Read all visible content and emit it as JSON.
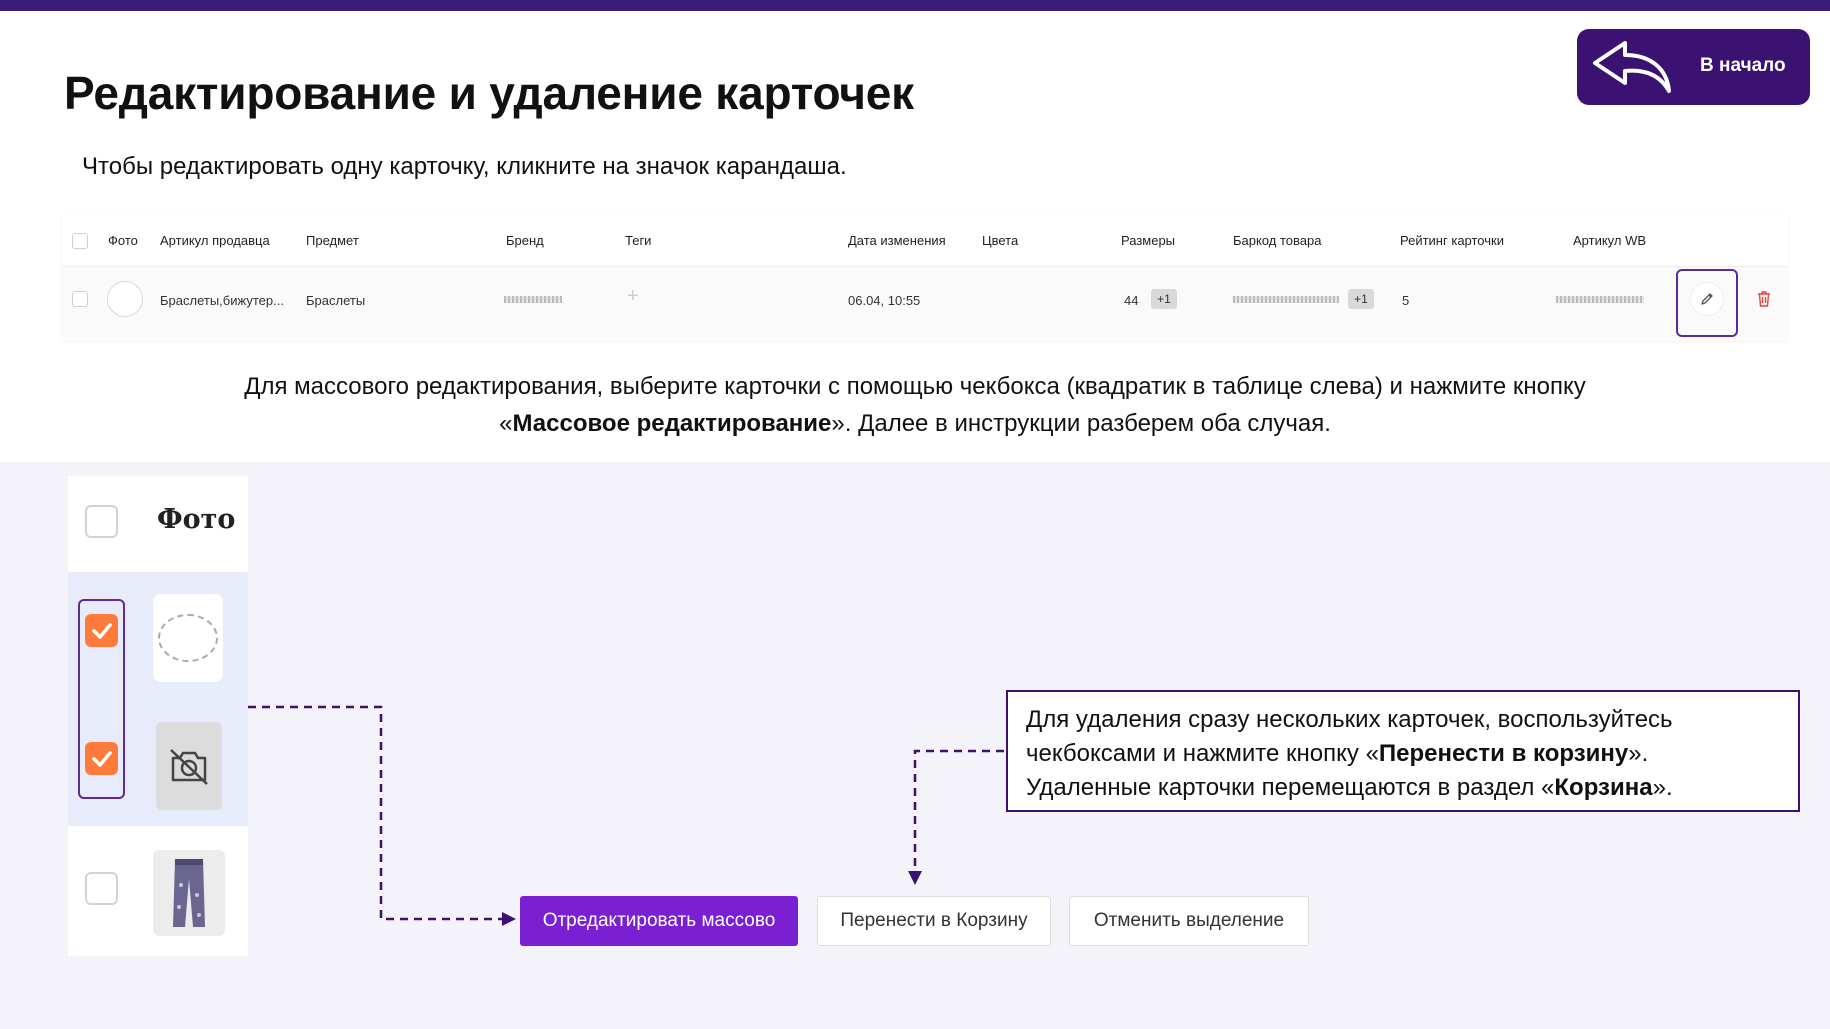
{
  "header": {
    "title": "Редактирование и удаление карточек",
    "home_button": "В начало",
    "subtitle": "Чтобы редактировать одну карточку, кликните на значок карандаша."
  },
  "table": {
    "columns": [
      "Фото",
      "Артикул продавца",
      "Предмет",
      "Бренд",
      "Теги",
      "Дата изменения",
      "Цвета",
      "Размеры",
      "Баркод товара",
      "Рейтинг карточки",
      "Артикул WB"
    ],
    "row": {
      "seller_article": "Браслеты,бижутер...",
      "subject": "Браслеты",
      "tags_add": "+",
      "date": "06.04, 10:55",
      "size": "44",
      "size_more": "+1",
      "barcode_more": "+1",
      "rating": "5"
    }
  },
  "mass_text": {
    "line1": "Для массового редактирования, выберите карточки с помощью чекбокса (квадратик в таблице слева) и нажмите кнопку",
    "quote_open": "«",
    "bold": "Массовое редактирование",
    "rest": "». Далее в инструкции разберем оба случая."
  },
  "mini_table": {
    "photo_header": "Фото"
  },
  "buttons": {
    "mass_edit": "Отредактировать массово",
    "move_to_trash": "Перенести в Корзину",
    "cancel_selection": "Отменить выделение"
  },
  "callout": {
    "part1": "Для удаления сразу нескольких карточек, воспользуйтесь чекбоксами и нажмите кнопку «",
    "bold1": "Перенести в корзину",
    "part2": "». Удаленные карточки перемещаются в раздел «",
    "bold2": "Корзина",
    "part3": "»."
  },
  "colors": {
    "brand_dark": "#3b1172",
    "accent_purple": "#7a1fd2",
    "checkbox_orange": "#ff7a3d",
    "frame_purple": "#5b2a9b"
  }
}
